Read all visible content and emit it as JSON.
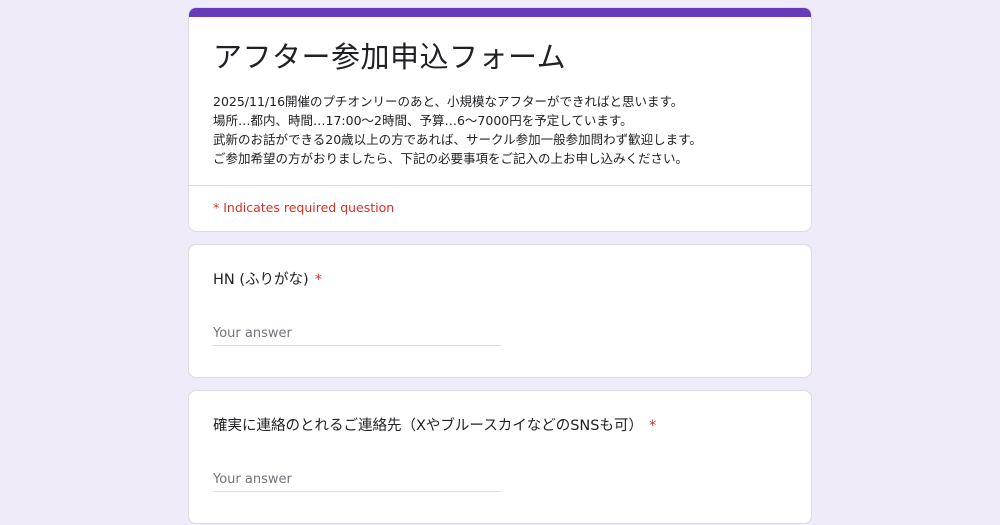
{
  "form": {
    "title": "アフター参加申込フォーム",
    "description": [
      "2025/11/16開催のプチオンリーのあと、小規模なアフターができればと思います。",
      "場所…都内、時間…17:00～2時間、予算…6～7000円を予定しています。",
      "武新のお話ができる20歳以上の方であれば、サークル参加一般参加問わず歓迎します。",
      "ご参加希望の方がおりましたら、下記の必要事項をご記入の上お申し込みください。"
    ],
    "required_note": "* Indicates required question",
    "accent_color": "#673ab7",
    "required_color": "#d93025"
  },
  "questions": [
    {
      "label": "HN (ふりがな)",
      "required_mark": "*",
      "placeholder": "Your answer"
    },
    {
      "label": "確実に連絡のとれるご連絡先（XやブルースカイなどのSNSも可）",
      "required_mark": "*",
      "placeholder": "Your answer"
    }
  ]
}
